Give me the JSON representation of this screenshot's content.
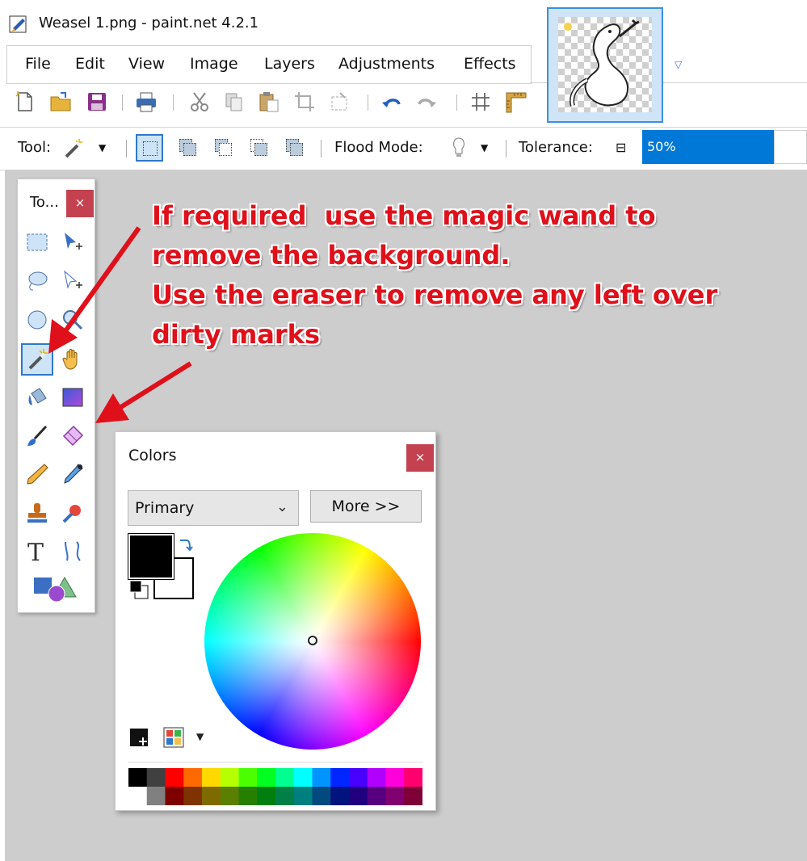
{
  "window": {
    "title": "Weasel 1.png - paint.net 4.2.1"
  },
  "menu": {
    "items": [
      "File",
      "Edit",
      "View",
      "Image",
      "Layers",
      "Adjustments",
      "Effects"
    ]
  },
  "tool_options": {
    "tool_label": "Tool:",
    "flood_mode_label": "Flood Mode:",
    "tolerance_label": "Tolerance:",
    "tolerance_value": "50%",
    "tolerance_fraction": 0.5
  },
  "tools_window": {
    "title": "To...",
    "close": "×",
    "selected_tool": "magic-wand",
    "tools": [
      "rectangle-select",
      "move-selected-pixels",
      "lasso-select",
      "move-selection",
      "ellipse-select",
      "zoom",
      "magic-wand",
      "pan",
      "paint-bucket",
      "gradient",
      "paintbrush",
      "eraser",
      "pencil",
      "color-picker",
      "clone-stamp",
      "recolor",
      "text",
      "line-curve",
      "shapes"
    ]
  },
  "colors_window": {
    "title": "Colors",
    "close": "×",
    "mode_select": "Primary",
    "more_button": "More >>",
    "primary_color": "#000000",
    "secondary_color": "#ffffff",
    "palette_top": [
      "#000000",
      "#404040",
      "#ff0000",
      "#ff6a00",
      "#ffd800",
      "#b6ff00",
      "#4cff00",
      "#00ff21",
      "#00ff90",
      "#00ffff",
      "#0094ff",
      "#0026ff",
      "#4800ff",
      "#b200ff",
      "#ff00dc",
      "#ff006e"
    ],
    "palette_bottom": [
      "#ffffff",
      "#808080",
      "#7f0000",
      "#7f3300",
      "#7f6a00",
      "#5b7f00",
      "#267f00",
      "#007f0e",
      "#007f46",
      "#007f7f",
      "#004a7f",
      "#00137f",
      "#21007f",
      "#57007f",
      "#7f006e",
      "#7f0037"
    ]
  },
  "annotation": {
    "lines": [
      "If required  use the magic wand to",
      "remove the background.",
      "Use the eraser to remove any left over",
      "dirty marks"
    ],
    "color": "#e0101a"
  }
}
